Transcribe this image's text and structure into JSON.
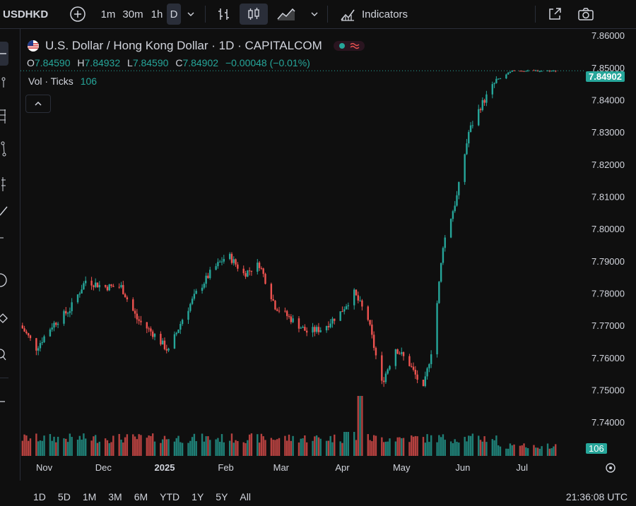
{
  "toolbar": {
    "symbol": "USDHKD",
    "intervals": [
      "1m",
      "30m",
      "1h",
      "D"
    ],
    "active_interval": "D",
    "indicators_label": "Indicators",
    "icons": [
      "add-symbol-icon",
      "chevron-down-icon",
      "bar-chart-icon",
      "candlestick-icon",
      "area-chart-icon",
      "indicators-icon",
      "fullscreen-icon",
      "camera-icon"
    ]
  },
  "legend": {
    "title": "U.S. Dollar / Hong Kong Dollar · 1D · CAPITALCOM",
    "open_label": "O",
    "open": "7.84590",
    "high_label": "H",
    "high": "7.84932",
    "low_label": "L",
    "low": "7.84590",
    "close_label": "C",
    "close": "7.84902",
    "change": "−0.00048 (−0.01%)",
    "vol_label": "Vol · Ticks",
    "vol_value": "106"
  },
  "price_axis": {
    "labels": [
      "7.86000",
      "7.85000",
      "7.84000",
      "7.83000",
      "7.82000",
      "7.81000",
      "7.80000",
      "7.79000",
      "7.78000",
      "7.77000",
      "7.76000",
      "7.75000",
      "7.74000"
    ],
    "last_price": "7.84902",
    "volume_badge": "106"
  },
  "time_axis": {
    "labels": [
      "Nov",
      "Dec",
      "2025",
      "Feb",
      "Mar",
      "Apr",
      "May",
      "Jun",
      "Jul"
    ]
  },
  "bottom": {
    "ranges": [
      "1D",
      "5D",
      "1M",
      "3M",
      "6M",
      "YTD",
      "1Y",
      "5Y",
      "All"
    ],
    "clock": "21:36:08 UTC"
  },
  "colors": {
    "up": "#26a69a",
    "down": "#ef5350",
    "background": "#0f0f0f"
  },
  "chart_data": {
    "type": "candlestick",
    "title": "U.S. Dollar / Hong Kong Dollar · 1D · CAPITALCOM",
    "ylim": [
      7.735,
      7.862
    ],
    "x_labels": [
      "Nov",
      "Dec",
      "2025",
      "Feb",
      "Mar",
      "Apr",
      "May",
      "Jun",
      "Jul"
    ],
    "close_path": [
      [
        "2024-10-20",
        7.77
      ],
      [
        "2024-10-28",
        7.763
      ],
      [
        "2024-11-05",
        7.77
      ],
      [
        "2024-11-14",
        7.775
      ],
      [
        "2024-11-22",
        7.784
      ],
      [
        "2024-12-01",
        7.782
      ],
      [
        "2024-12-10",
        7.782
      ],
      [
        "2024-12-18",
        7.772
      ],
      [
        "2024-12-27",
        7.767
      ],
      [
        "2025-01-03",
        7.762
      ],
      [
        "2025-01-10",
        7.772
      ],
      [
        "2025-01-17",
        7.78
      ],
      [
        "2025-01-25",
        7.787
      ],
      [
        "2025-02-02",
        7.792
      ],
      [
        "2025-02-10",
        7.786
      ],
      [
        "2025-02-18",
        7.789
      ],
      [
        "2025-02-26",
        7.776
      ],
      [
        "2025-03-06",
        7.772
      ],
      [
        "2025-03-14",
        7.768
      ],
      [
        "2025-03-22",
        7.769
      ],
      [
        "2025-03-31",
        7.774
      ],
      [
        "2025-04-07",
        7.78
      ],
      [
        "2025-04-14",
        7.772
      ],
      [
        "2025-04-21",
        7.752
      ],
      [
        "2025-04-28",
        7.763
      ],
      [
        "2025-05-05",
        7.758
      ],
      [
        "2025-05-12",
        7.75
      ],
      [
        "2025-05-17",
        7.765
      ],
      [
        "2025-05-22",
        7.795
      ],
      [
        "2025-05-29",
        7.81
      ],
      [
        "2025-06-04",
        7.83
      ],
      [
        "2025-06-10",
        7.838
      ],
      [
        "2025-06-18",
        7.846
      ],
      [
        "2025-06-26",
        7.849
      ],
      [
        "2025-07-05",
        7.849
      ],
      [
        "2025-07-14",
        7.849
      ],
      [
        "2025-07-19",
        7.849
      ]
    ],
    "volume": "106"
  }
}
